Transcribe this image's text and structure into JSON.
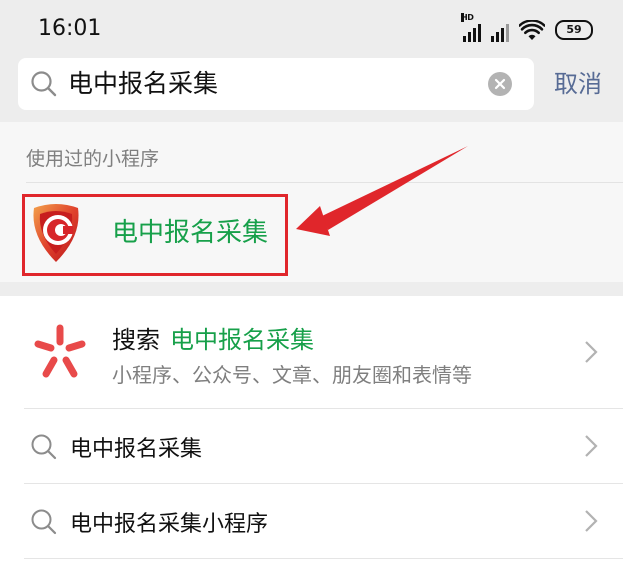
{
  "status_bar": {
    "time": "16:01",
    "network_badge": "HD",
    "battery_level": "59"
  },
  "search": {
    "query": "电中报名采集",
    "cancel_label": "取消"
  },
  "used_section": {
    "title": "使用过的小程序",
    "items": [
      {
        "name": "电中报名采集"
      }
    ]
  },
  "results": {
    "search_all": {
      "prefix": "搜索",
      "keyword": "电中报名采集",
      "subtitle": "小程序、公众号、文章、朋友圈和表情等"
    },
    "suggestions": [
      {
        "text": "电中报名采集"
      },
      {
        "text": "电中报名采集小程序"
      }
    ]
  },
  "colors": {
    "accent_green": "#17a04a",
    "link_blue": "#576b95",
    "annotation_red": "#e0262b",
    "search_all_icon": "#e84a4a"
  }
}
